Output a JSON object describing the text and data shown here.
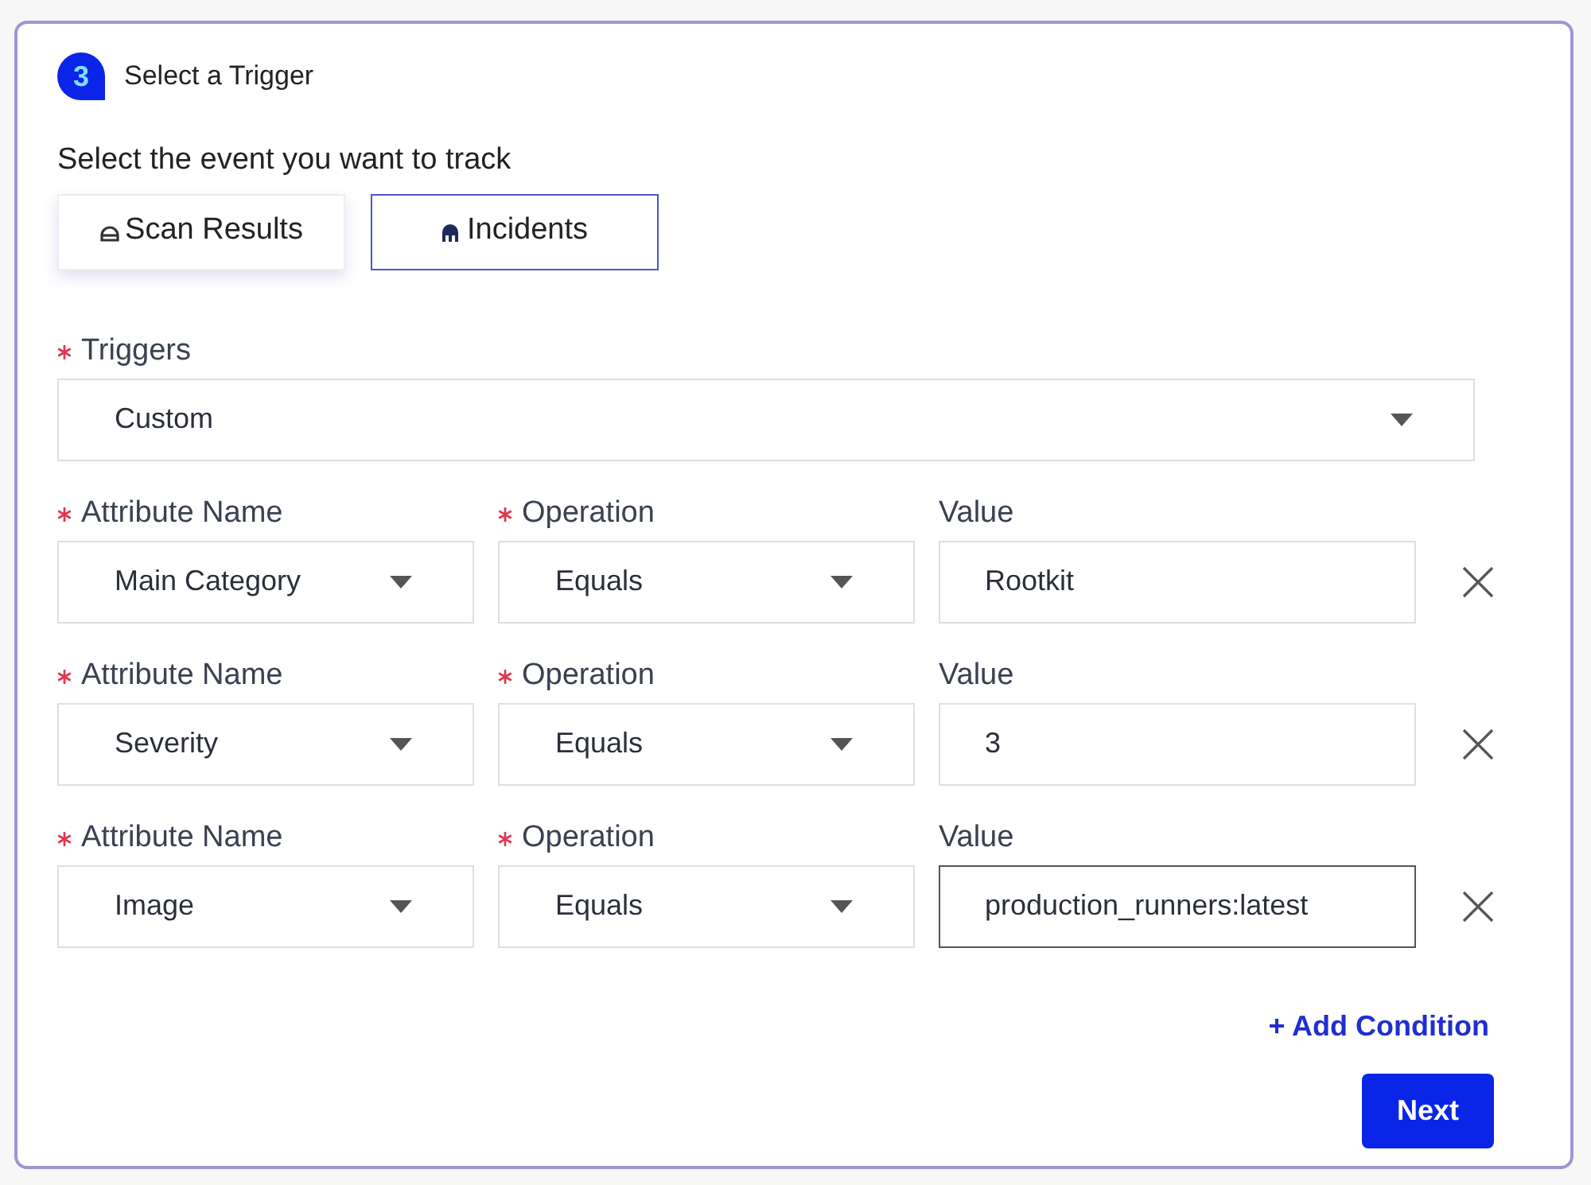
{
  "step": {
    "number": "3",
    "title": "Select a Trigger"
  },
  "event_prompt": "Select the event you want to track",
  "events": [
    {
      "label": "Scan Results",
      "kind": "scan",
      "selected": false
    },
    {
      "label": "Incidents",
      "kind": "incident",
      "selected": true
    }
  ],
  "triggers": {
    "label": "Triggers",
    "required": true,
    "value": "Custom"
  },
  "conditions": [
    {
      "attribute": {
        "label": "Attribute Name",
        "required": true,
        "value": "Main Category"
      },
      "operation": {
        "label": "Operation",
        "required": true,
        "value": "Equals"
      },
      "value": {
        "label": "Value",
        "required": false,
        "value": "Rootkit",
        "focused": false
      }
    },
    {
      "attribute": {
        "label": "Attribute Name",
        "required": true,
        "value": "Severity"
      },
      "operation": {
        "label": "Operation",
        "required": true,
        "value": "Equals"
      },
      "value": {
        "label": "Value",
        "required": false,
        "value": "3",
        "focused": false
      }
    },
    {
      "attribute": {
        "label": "Attribute Name",
        "required": true,
        "value": "Image"
      },
      "operation": {
        "label": "Operation",
        "required": true,
        "value": "Equals"
      },
      "value": {
        "label": "Value",
        "required": false,
        "value": "production_runners:latest",
        "focused": true
      }
    }
  ],
  "add_condition": "+ Add Condition",
  "next_button": "Next"
}
